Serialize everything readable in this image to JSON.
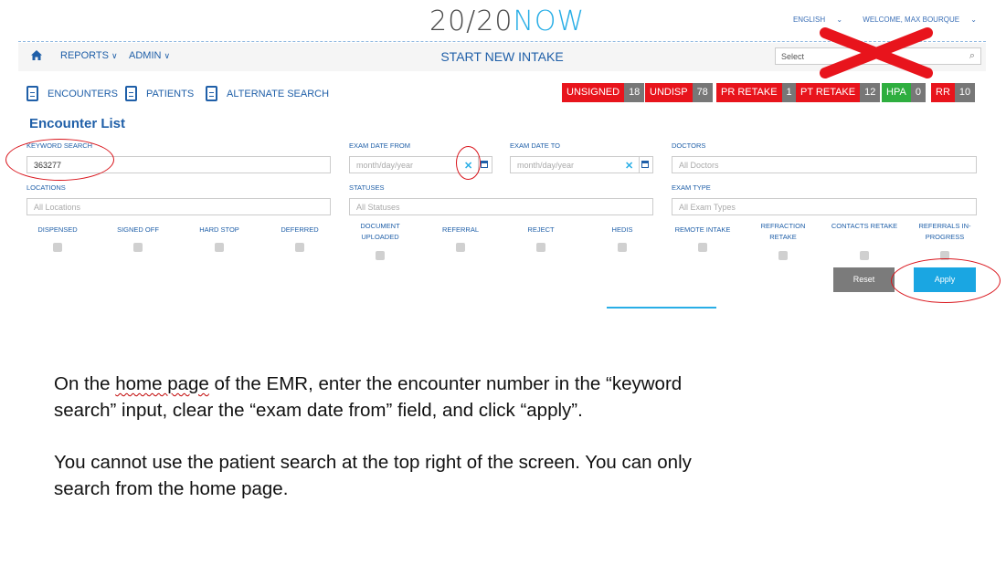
{
  "header": {
    "logo_part1": "20/20",
    "logo_part2": "NOW",
    "language": "ENGLISH",
    "welcome": "WELCOME, MAX BOURQUE"
  },
  "navbar": {
    "reports": "REPORTS",
    "admin": "ADMIN",
    "title": "START NEW INTAKE",
    "patient_select_placeholder": "Select"
  },
  "subnav": {
    "encounters": "ENCOUNTERS",
    "patients": "PATIENTS",
    "alternate_search": "ALTERNATE SEARCH"
  },
  "badges": [
    {
      "label": "UNSIGNED",
      "count": "18",
      "color": "#e8141c"
    },
    {
      "label": "UNDISP",
      "count": "78",
      "color": "#e8141c"
    },
    {
      "label": "PR RETAKE",
      "count": "1",
      "color": "#e8141c"
    },
    {
      "label": "PT RETAKE",
      "count": "12",
      "color": "#e8141c"
    },
    {
      "label": "HPA",
      "count": "0",
      "color": "#2eae3f"
    },
    {
      "label": "RR",
      "count": "10",
      "color": "#e8141c"
    }
  ],
  "encounter_list": {
    "heading": "Encounter List",
    "keyword_label": "KEYWORD SEARCH",
    "keyword_value": "363277",
    "exam_from_label": "EXAM DATE FROM",
    "exam_from_placeholder": "month/day/year",
    "exam_to_label": "EXAM DATE TO",
    "exam_to_placeholder": "month/day/year",
    "doctors_label": "DOCTORS",
    "doctors_placeholder": "All Doctors",
    "locations_label": "LOCATIONS",
    "locations_placeholder": "All Locations",
    "statuses_label": "STATUSES",
    "statuses_placeholder": "All Statuses",
    "exam_type_label": "EXAM TYPE",
    "exam_type_placeholder": "All Exam Types"
  },
  "checkboxes": [
    {
      "label": "DISPENSED",
      "checked": false
    },
    {
      "label": "SIGNED OFF",
      "checked": false
    },
    {
      "label": "HARD STOP",
      "checked": false
    },
    {
      "label": "DEFERRED",
      "checked": false
    },
    {
      "label": "DOCUMENT UPLOADED",
      "checked": false
    },
    {
      "label": "REFERRAL",
      "checked": false
    },
    {
      "label": "REJECT",
      "checked": false
    },
    {
      "label": "HEDIS",
      "checked": false
    },
    {
      "label": "REMOTE INTAKE",
      "checked": false
    },
    {
      "label": "REFRACTION RETAKE",
      "checked": false
    },
    {
      "label": "CONTACTS RETAKE",
      "checked": false
    },
    {
      "label": "REFERRALS IN-PROGRESS",
      "checked": false
    }
  ],
  "buttons": {
    "reset": "Reset",
    "apply": "Apply"
  },
  "instructions": {
    "line1_pre": "On the ",
    "line1_squiggle": "home page",
    "line1_post": " of the EMR, enter the encounter number in the “keyword",
    "line2": "search” input, clear the “exam date from” field, and click “apply”.",
    "line3": "You cannot use the patient search at the top right of the screen. You can only",
    "line4": "search from the home page."
  },
  "colors": {
    "brand_blue": "#1f5fa8",
    "accent_cyan": "#29aee6",
    "annotation_red": "#d9141b"
  }
}
